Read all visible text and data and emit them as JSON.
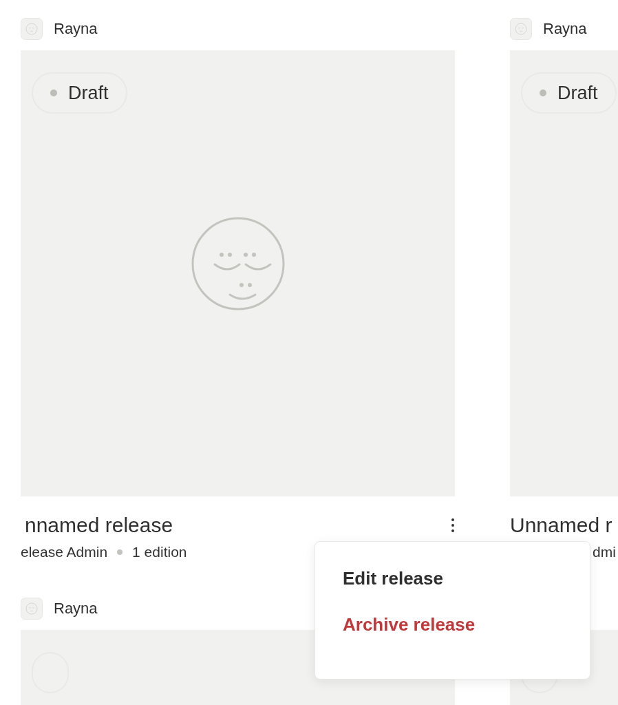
{
  "cards": [
    {
      "author": "Rayna",
      "status_pill": true,
      "status": "Draft",
      "title": "nnamed release",
      "meta": [
        "elease Admin",
        "1 edition"
      ],
      "more_button": true
    },
    {
      "author": "Rayna",
      "status_pill": true,
      "status": "Draft",
      "title": "Unnamed r",
      "meta_partial": "dmi"
    },
    {
      "author": "Rayna",
      "status_pill": true
    },
    {
      "status_pill": true
    }
  ],
  "menu": {
    "items": [
      {
        "label": "Edit release",
        "kind": "normal"
      },
      {
        "label": "Archive release",
        "kind": "danger"
      }
    ]
  }
}
